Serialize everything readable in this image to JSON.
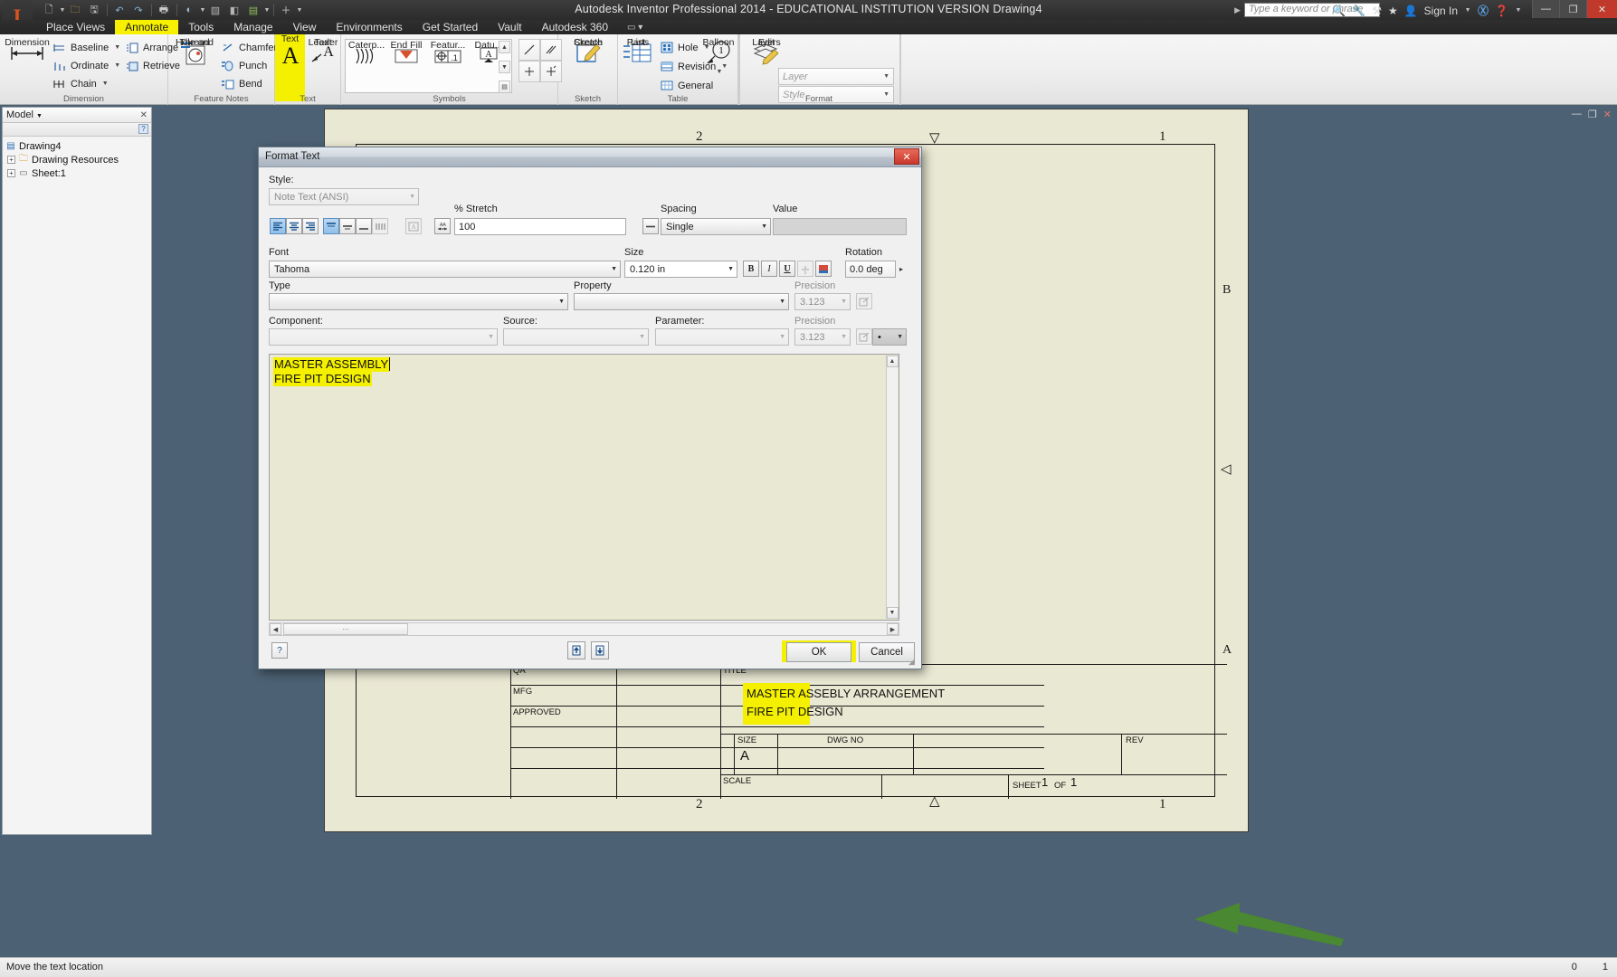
{
  "titlebar": {
    "app_title": "Autodesk Inventor Professional 2014 - EDUCATIONAL INSTITUTION VERSION    Drawing4",
    "search_placeholder": "Type a keyword or phrase",
    "sign_in": "Sign In",
    "quick_access": [
      {
        "name": "new-icon",
        "glyph": "⬜"
      },
      {
        "name": "open-icon",
        "glyph": "📂"
      },
      {
        "name": "save-icon",
        "glyph": "💾"
      },
      {
        "name": "undo-icon",
        "glyph": "↶"
      },
      {
        "name": "redo-icon",
        "glyph": "↷"
      },
      {
        "name": "print-icon",
        "glyph": "🖨"
      },
      {
        "name": "update-icon",
        "glyph": "↺"
      },
      {
        "name": "select-icon",
        "glyph": "⬚"
      },
      {
        "name": "return-icon",
        "glyph": "⤴"
      },
      {
        "name": "appearance-icon",
        "glyph": "◳"
      },
      {
        "name": "plus-icon",
        "glyph": "＋"
      }
    ],
    "window_buttons": [
      {
        "name": "minimize-button",
        "glyph": "—"
      },
      {
        "name": "restore-button",
        "glyph": "❐"
      },
      {
        "name": "close-button",
        "glyph": "✕"
      }
    ]
  },
  "tabs": [
    {
      "label": "Place Views",
      "active": false
    },
    {
      "label": "Annotate",
      "active": true
    },
    {
      "label": "Tools",
      "active": false
    },
    {
      "label": "Manage",
      "active": false
    },
    {
      "label": "View",
      "active": false
    },
    {
      "label": "Environments",
      "active": false
    },
    {
      "label": "Get Started",
      "active": false
    },
    {
      "label": "Vault",
      "active": false
    },
    {
      "label": "Autodesk 360",
      "active": false
    }
  ],
  "ribbon": {
    "panels": [
      {
        "label": "Dimension"
      },
      {
        "label": "Feature Notes"
      },
      {
        "label": "Text"
      },
      {
        "label": "Symbols"
      },
      {
        "label": "Sketch"
      },
      {
        "label": "Table"
      },
      {
        "label": "Format"
      }
    ],
    "dimension": {
      "main": "Dimension",
      "baseline": "Baseline",
      "ordinate": "Ordinate",
      "chain": "Chain",
      "arrange": "Arrange",
      "retrieve": "Retrieve"
    },
    "feature_notes": {
      "hole_thread": "Hole and\nThread",
      "hole_thread_l1": "Hole and",
      "hole_thread_l2": "Thread",
      "chamfer": "Chamfer",
      "punch": "Punch",
      "bend": "Bend"
    },
    "text": {
      "text": "Text",
      "leader_l1": "Leader",
      "leader_l2": "Text"
    },
    "symbols": {
      "caterpillar": "Caterp...",
      "end_fill": "End Fill",
      "feature": "Featur...",
      "datum": "Datu..."
    },
    "sketch": {
      "create_l1": "Create",
      "create_l2": "Sketch"
    },
    "table": {
      "parts_l1": "Parts",
      "parts_l2": "List",
      "hole": "Hole",
      "revision": "Revision",
      "general": "General",
      "balloon": "Balloon"
    },
    "format": {
      "edit_l1": "Edit",
      "edit_l2": "Layers",
      "layer": "Layer",
      "style": "Style"
    }
  },
  "browser": {
    "title": "Model",
    "tree": [
      {
        "label": "Drawing4",
        "icon": "drawing-icon",
        "depth": 0,
        "expandable": false
      },
      {
        "label": "Drawing Resources",
        "icon": "folder-icon",
        "depth": 1,
        "expandable": true
      },
      {
        "label": "Sheet:1",
        "icon": "sheet-icon",
        "depth": 1,
        "expandable": true
      }
    ]
  },
  "dialog": {
    "title": "Format Text",
    "style_label": "Style:",
    "style_value": "Note Text (ANSI)",
    "stretch_label": "% Stretch",
    "stretch_value": "100",
    "spacing_label": "Spacing",
    "spacing_value": "Single",
    "value_label": "Value",
    "value_value": "",
    "font_label": "Font",
    "font_value": "Tahoma",
    "size_label": "Size",
    "size_value": "0.120 in",
    "rotation_label": "Rotation",
    "rotation_value": "0.0 deg",
    "bold": "B",
    "italic": "I",
    "underline": "U",
    "type_label": "Type",
    "type_value": "",
    "property_label": "Property",
    "property_value": "",
    "precision_label": "Precision",
    "precision_value": "3.123",
    "component_label": "Component:",
    "component_value": "",
    "source_label": "Source:",
    "source_value": "",
    "parameter_label": "Parameter:",
    "parameter_value": "",
    "precision2_label": "Precision",
    "precision2_value": "3.123",
    "symbol_value": "•",
    "text_line1": "MASTER ASSEMBLY",
    "text_line2": "FIRE PIT DESIGN",
    "ok_label": "OK",
    "cancel_label": "Cancel",
    "help_label": "?",
    "align_buttons": [
      {
        "name": "align-left-button",
        "glyph": "☰",
        "active": true
      },
      {
        "name": "align-center-button",
        "glyph": "☰",
        "active": false
      },
      {
        "name": "align-right-button",
        "glyph": "☰",
        "active": false
      },
      {
        "name": "align-top-button",
        "glyph": "☰",
        "active": true
      },
      {
        "name": "align-middle-button",
        "glyph": "☰",
        "active": false
      },
      {
        "name": "align-bottom-button",
        "glyph": "☰",
        "active": false
      },
      {
        "name": "text-width-button",
        "glyph": "↔",
        "active": false
      }
    ]
  },
  "sheet": {
    "zone_top_left": "2",
    "zone_top_right": "1",
    "zone_bottom_left": "2",
    "zone_bottom_right": "1",
    "zone_row_b": "B",
    "zone_row_a": "A",
    "titleblock": {
      "qa": "QA",
      "mfg": "MFG",
      "approved": "APPROVED",
      "title_label": "TITLE",
      "title_line1": "MASTER ASSEBLY ARRANGEMENT",
      "title_line2": "FIRE PIT DESIGN",
      "size_label": "SIZE",
      "size_value": "A",
      "dwg_no_label": "DWG NO",
      "rev_label": "REV",
      "scale_label": "SCALE",
      "sheet_label": "SHEET",
      "sheet_num": "1",
      "sheet_of": "OF",
      "sheet_total": "1"
    }
  },
  "statusbar": {
    "message": "Move the text location",
    "field1": "0",
    "field2": "1"
  },
  "colors": {
    "accent_yellow": "#f4f000",
    "sheet_bg": "#e9e8d3",
    "canvas_bg": "#4c6173",
    "arrow_green": "#4a8a2d"
  }
}
